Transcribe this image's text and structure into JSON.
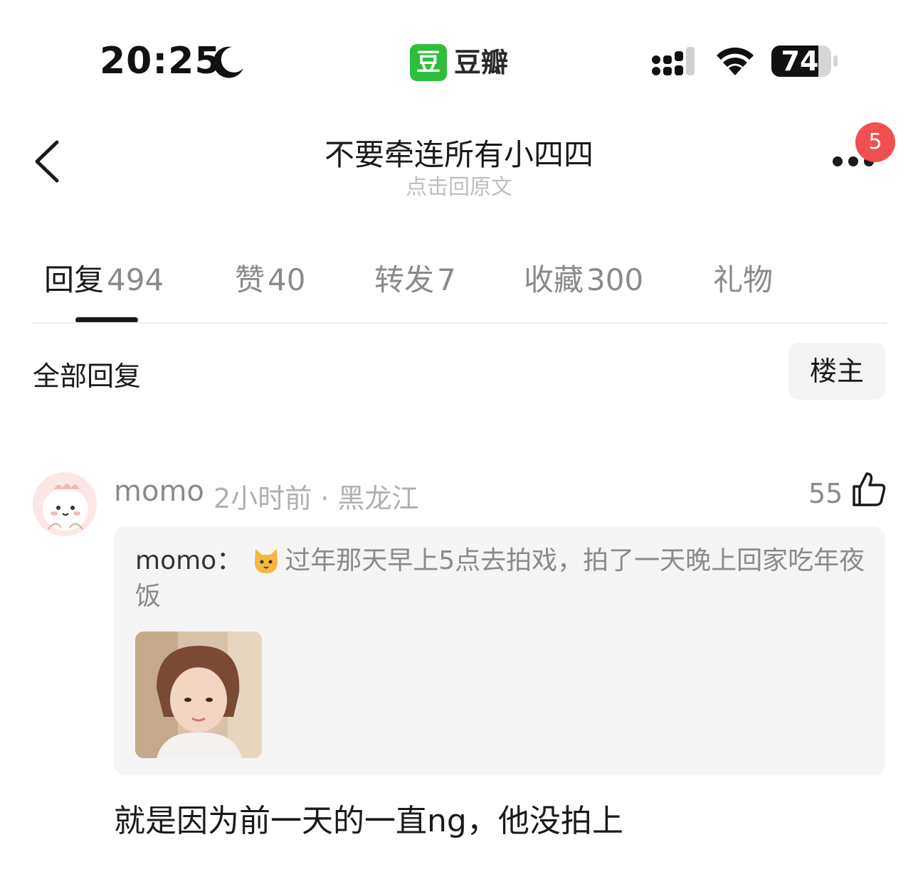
{
  "status_bar": {
    "time": "20:25",
    "app_badge": "豆",
    "app_name": "豆瓣",
    "battery": "74"
  },
  "nav": {
    "title": "不要牵连所有小四四",
    "subtitle": "点击回原文",
    "notification_count": "5"
  },
  "tabs": [
    {
      "label": "回复",
      "count": "494",
      "active": true
    },
    {
      "label": "赞",
      "count": "40",
      "active": false
    },
    {
      "label": "转发",
      "count": "7",
      "active": false
    },
    {
      "label": "收藏",
      "count": "300",
      "active": false
    },
    {
      "label": "礼物",
      "count": "",
      "active": false
    }
  ],
  "filter": {
    "all_replies": "全部回复",
    "op_only": "楼主"
  },
  "comment": {
    "username": "momo",
    "meta": "2小时前 · 黑龙江",
    "likes": "55",
    "quote": {
      "name": "momo：",
      "emoji": "cat-face-icon",
      "text": "过年那天早上5点去拍戏，拍了一天晚上回家吃年夜饭"
    },
    "reply": "就是因为前一天的一直ng，他没拍上"
  },
  "colors": {
    "brand_green": "#2dbf3a",
    "badge_red": "#f05050",
    "muted_text": "#8a8a8a"
  }
}
